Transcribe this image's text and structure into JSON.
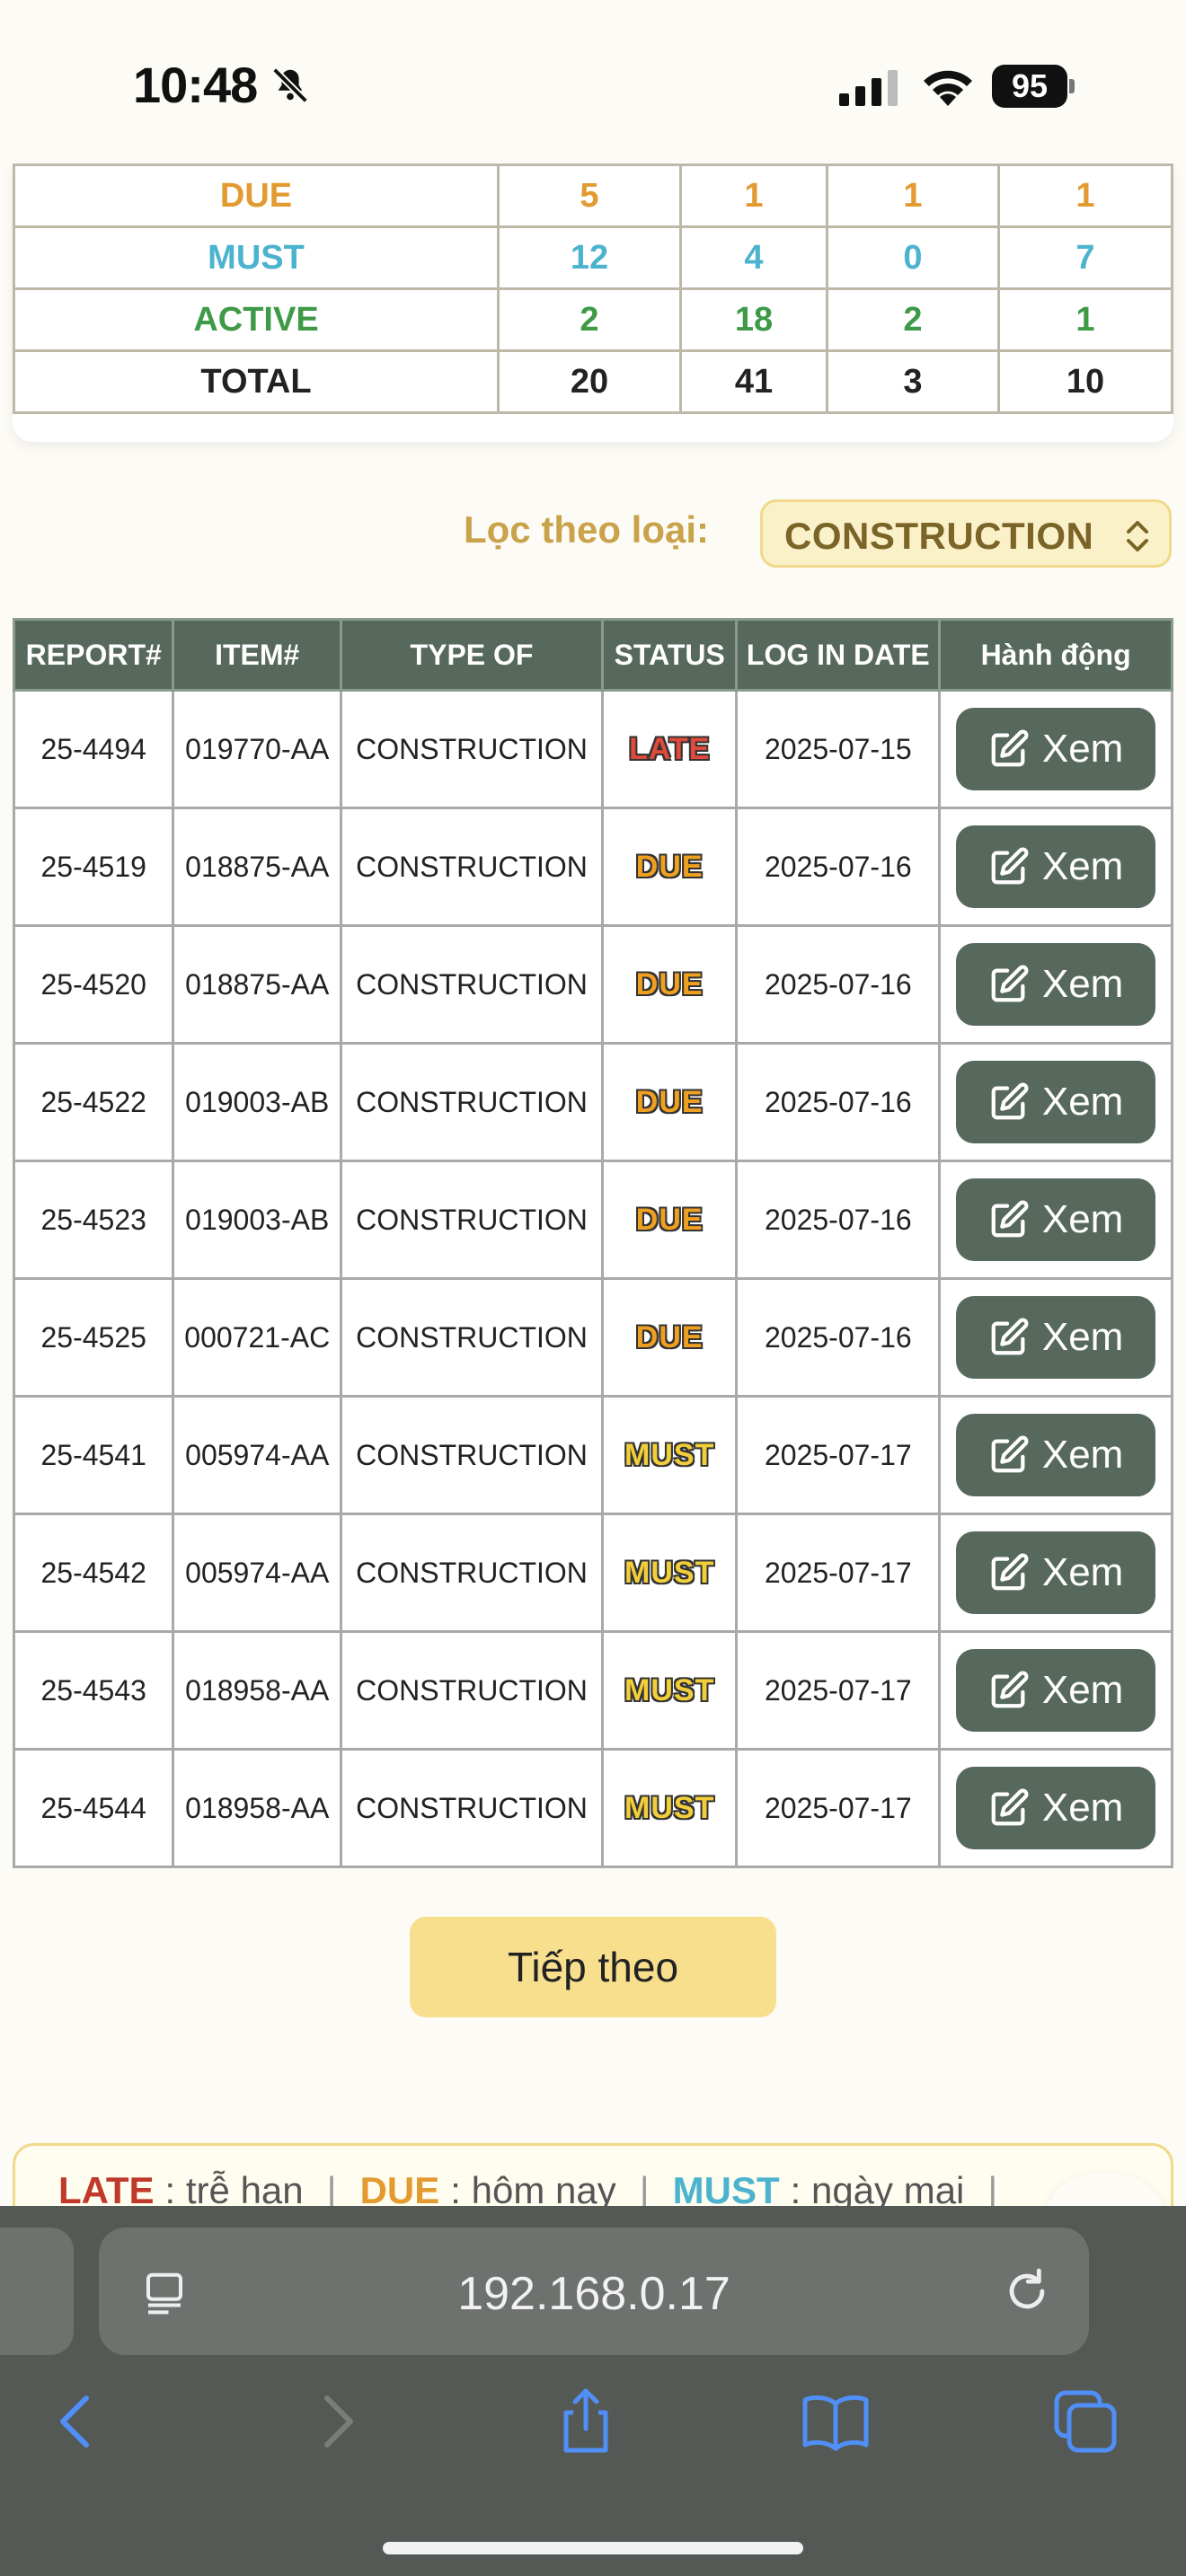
{
  "status_bar": {
    "time": "10:48",
    "battery": "95"
  },
  "summary": {
    "rows": [
      {
        "label": "DUE",
        "values": [
          "5",
          "1",
          "1",
          "1"
        ],
        "color": "#e39a30"
      },
      {
        "label": "MUST",
        "values": [
          "12",
          "4",
          "0",
          "7"
        ],
        "color": "#4cb3cf"
      },
      {
        "label": "ACTIVE",
        "values": [
          "2",
          "18",
          "2",
          "1"
        ],
        "color": "#3f9a48"
      },
      {
        "label": "TOTAL",
        "values": [
          "20",
          "41",
          "3",
          "10"
        ],
        "color": "#222222"
      }
    ]
  },
  "filter": {
    "label": "Lọc theo loại:",
    "value": "CONSTRUCTION"
  },
  "table": {
    "headers": [
      "REPORT#",
      "ITEM#",
      "TYPE OF",
      "STATUS",
      "LOG IN DATE",
      "Hành động"
    ],
    "action_label": "Xem",
    "rows": [
      {
        "report": "25-4494",
        "item": "019770-AA",
        "type": "CONSTRUCTION",
        "status": "LATE",
        "date": "2025-07-15"
      },
      {
        "report": "25-4519",
        "item": "018875-AA",
        "type": "CONSTRUCTION",
        "status": "DUE",
        "date": "2025-07-16"
      },
      {
        "report": "25-4520",
        "item": "018875-AA",
        "type": "CONSTRUCTION",
        "status": "DUE",
        "date": "2025-07-16"
      },
      {
        "report": "25-4522",
        "item": "019003-AB",
        "type": "CONSTRUCTION",
        "status": "DUE",
        "date": "2025-07-16"
      },
      {
        "report": "25-4523",
        "item": "019003-AB",
        "type": "CONSTRUCTION",
        "status": "DUE",
        "date": "2025-07-16"
      },
      {
        "report": "25-4525",
        "item": "000721-AC",
        "type": "CONSTRUCTION",
        "status": "DUE",
        "date": "2025-07-16"
      },
      {
        "report": "25-4541",
        "item": "005974-AA",
        "type": "CONSTRUCTION",
        "status": "MUST",
        "date": "2025-07-17"
      },
      {
        "report": "25-4542",
        "item": "005974-AA",
        "type": "CONSTRUCTION",
        "status": "MUST",
        "date": "2025-07-17"
      },
      {
        "report": "25-4543",
        "item": "018958-AA",
        "type": "CONSTRUCTION",
        "status": "MUST",
        "date": "2025-07-17"
      },
      {
        "report": "25-4544",
        "item": "018958-AA",
        "type": "CONSTRUCTION",
        "status": "MUST",
        "date": "2025-07-17"
      }
    ]
  },
  "pagination": {
    "next_label": "Tiếp theo"
  },
  "legend": {
    "items": [
      {
        "key": "LATE",
        "desc": ": trễ hạn"
      },
      {
        "key": "DUE",
        "desc": ": hôm nay"
      },
      {
        "key": "MUST",
        "desc": ": ngày mai"
      }
    ]
  },
  "browser": {
    "url": "192.168.0.17"
  },
  "icons": {
    "bell": "bell-slash-icon",
    "theme": "moon-icon",
    "action": "edit-icon",
    "reader": "reader-icon",
    "reload": "reload-icon",
    "back": "back-icon",
    "forward": "forward-icon",
    "share": "share-icon",
    "bookmarks": "bookmarks-icon",
    "tabs": "tabs-icon"
  }
}
